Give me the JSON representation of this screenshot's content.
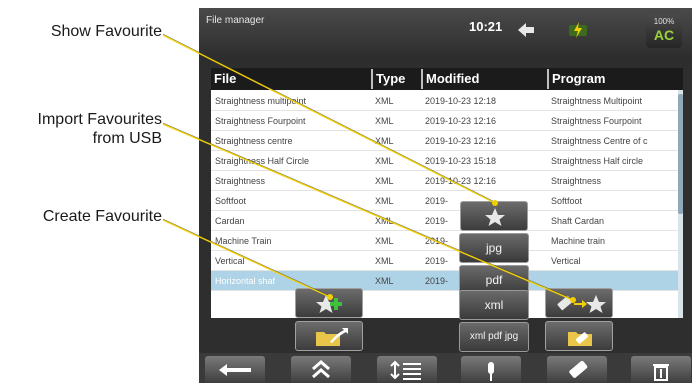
{
  "callouts": {
    "show_favourite": "Show Favourite",
    "import_line1": "Import Favourites",
    "import_line2": "from USB",
    "create_favourite": "Create Favourite"
  },
  "statusbar": {
    "title": "File manager",
    "time": "10:21",
    "battery": {
      "value": "100%",
      "symbol": "AC"
    }
  },
  "table": {
    "columns": [
      "File",
      "Type",
      "Modified",
      "Program"
    ],
    "rows": [
      [
        "Straightness multipoint",
        "XML",
        "2019-10-23 12:18",
        "Straightness Multipoint"
      ],
      [
        "Straightness Fourpoint",
        "XML",
        "2019-10-23 12:16",
        "Straightness Fourpoint"
      ],
      [
        "Straightness centre",
        "XML",
        "2019-10-23 12:16",
        "Straightness Centre of c"
      ],
      [
        "Straightness Half Circle",
        "XML",
        "2019-10-23 15:18",
        "Straightness Half circle"
      ],
      [
        "Straightness",
        "XML",
        "2019-10-23 12:16",
        "Straightness"
      ],
      [
        "Softfoot",
        "XML",
        "2019-",
        "Softfoot"
      ],
      [
        "Cardan",
        "XML",
        "2019-",
        "Shaft Cardan"
      ],
      [
        "Machine Train",
        "XML",
        "2019-",
        "Machine train"
      ],
      [
        "Vertical",
        "XML",
        "2019-",
        "Vertical"
      ],
      [
        "Horizontal shaf",
        "XML",
        "2019-",
        ""
      ]
    ],
    "selected_row": 9
  },
  "popup": {
    "options": [
      "jpg",
      "pdf",
      "xml",
      "xml pdf jpg"
    ]
  },
  "colors": {
    "accent_yellow": "#f2d000",
    "add_green": "#3ec13e",
    "selected_row": "#aed3e6"
  },
  "icons": {
    "show_favourite": "star-icon",
    "import_favourites": "usb-arrow-star-icon",
    "create_favourite": "star-plus-icon",
    "export_folder": "folder-arrow-icon",
    "usb_folder": "folder-usb-icon",
    "toolbar": [
      "back-arrow-icon",
      "double-chevron-up-icon",
      "sort-list-icon",
      "microphone-icon",
      "usb-stick-icon",
      "trash-icon"
    ]
  }
}
